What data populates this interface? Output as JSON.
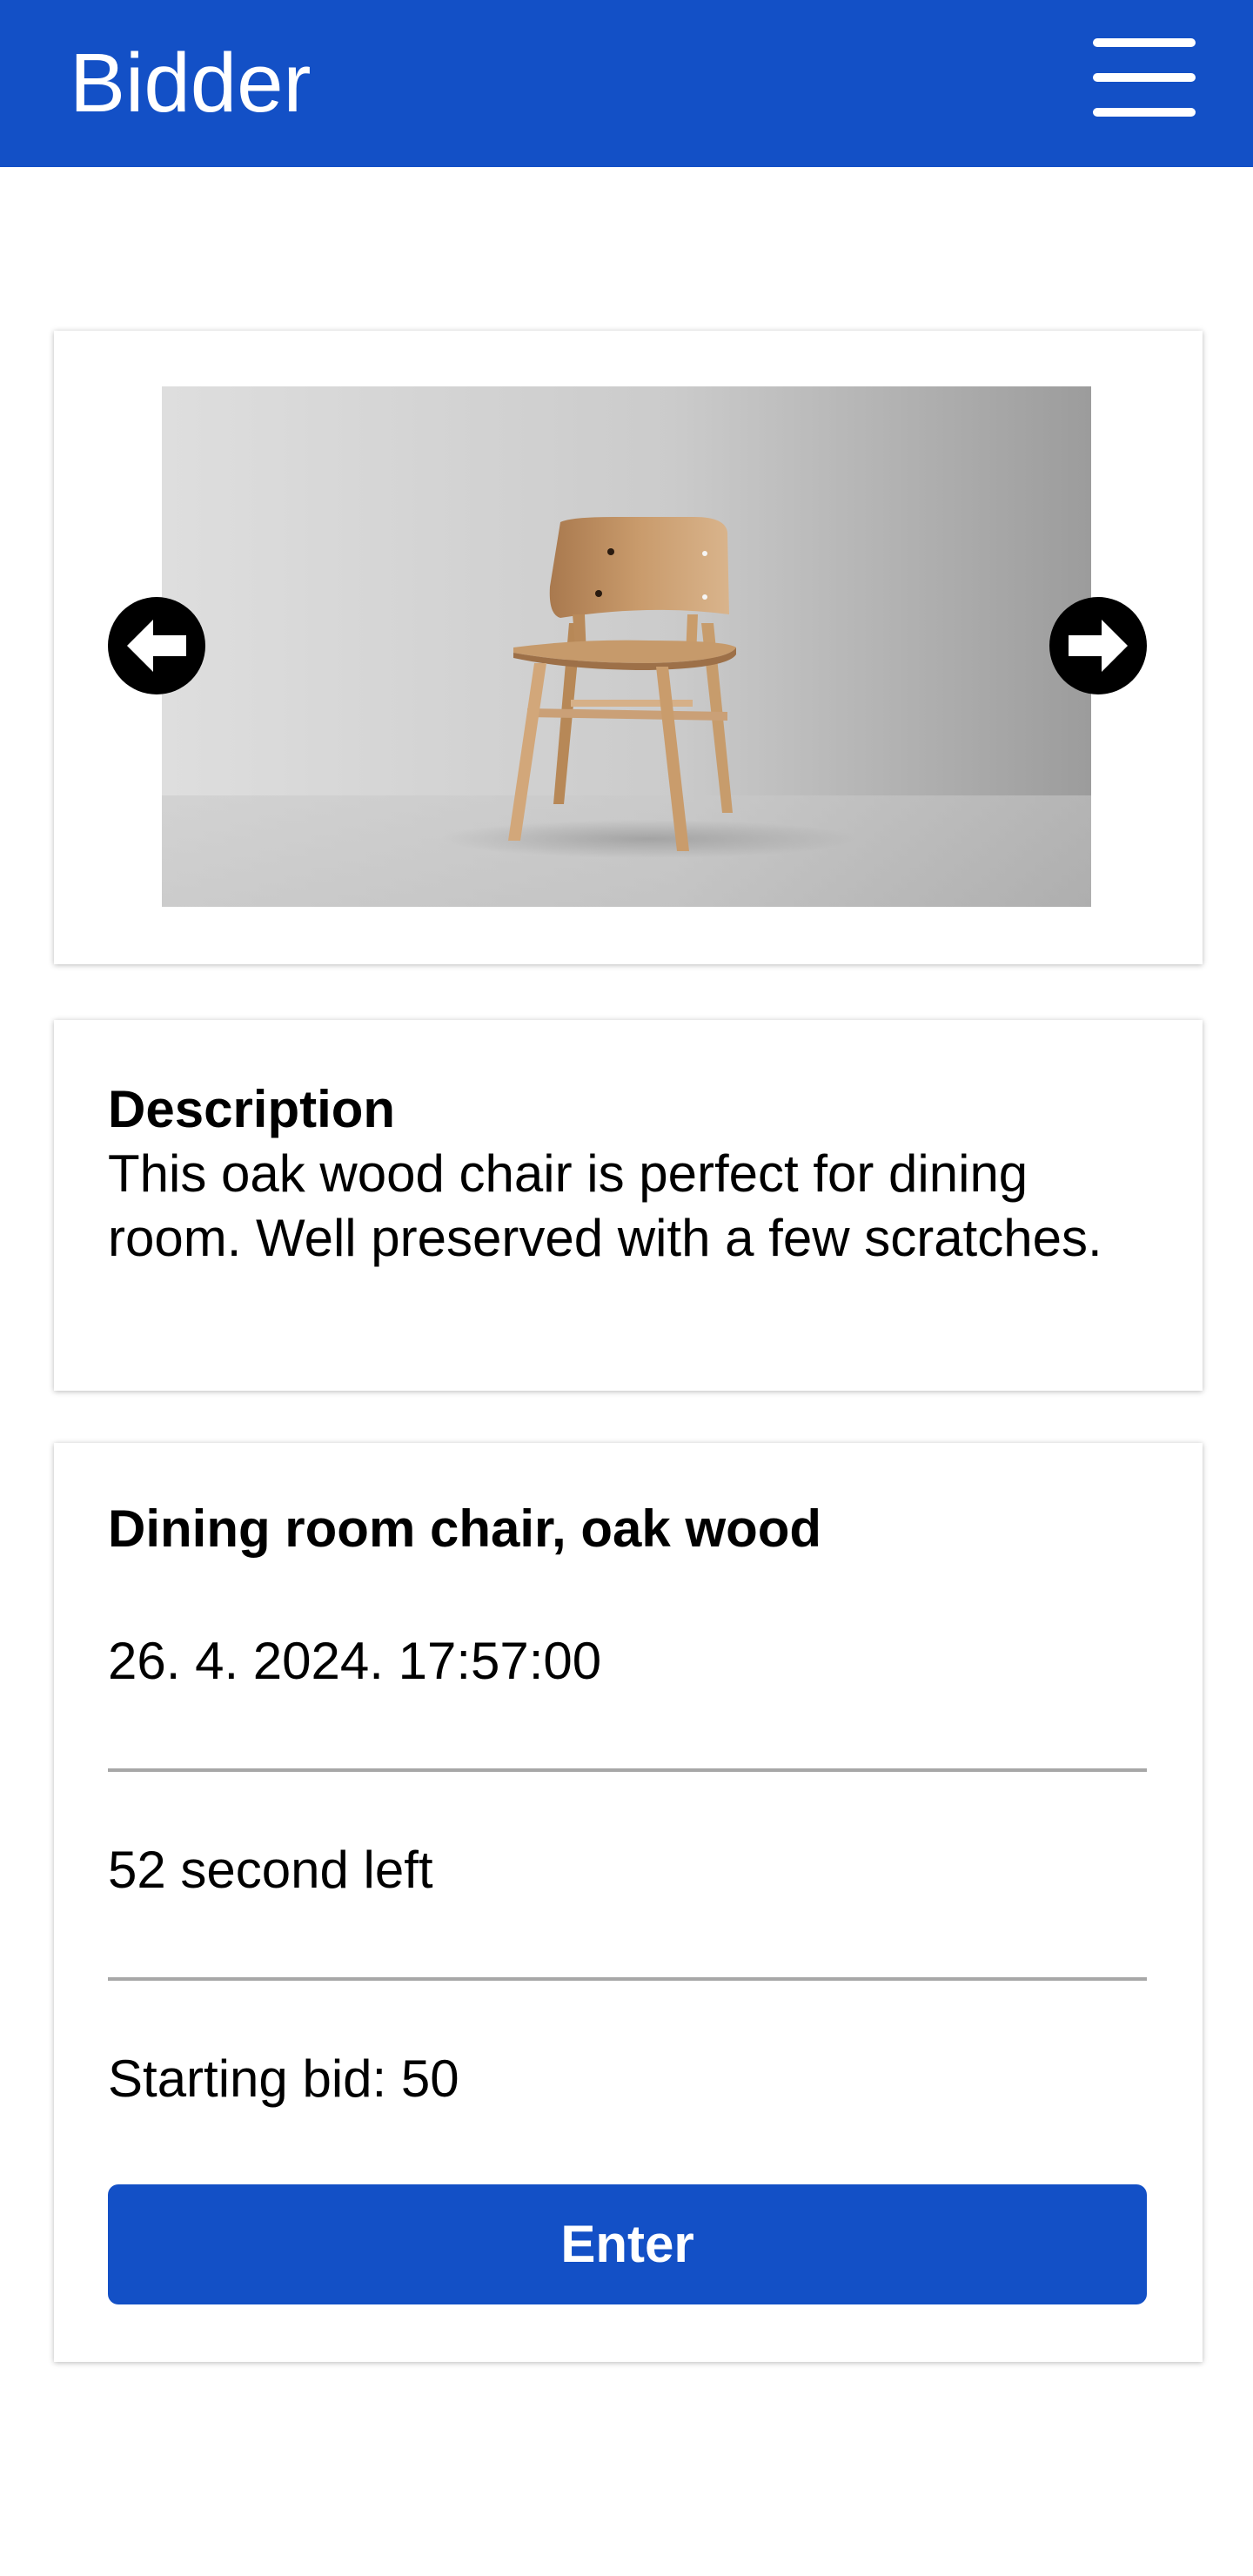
{
  "app": {
    "title": "Bidder",
    "brand_color": "#1350c6"
  },
  "header": {
    "menu_icon": "hamburger-menu-icon"
  },
  "gallery": {
    "image_description": "oak wood dining chair",
    "prev_icon": "arrow-left-circle-icon",
    "next_icon": "arrow-right-circle-icon"
  },
  "description": {
    "heading": "Description",
    "text": "This oak wood chair is perfect for dining room. Well preserved with a few scratches."
  },
  "item": {
    "name": "Dining room chair, oak wood",
    "datetime": "26. 4. 2024. 17:57:00",
    "time_left": "52 second left",
    "starting_bid": "Starting bid: 50",
    "enter_label": "Enter"
  }
}
